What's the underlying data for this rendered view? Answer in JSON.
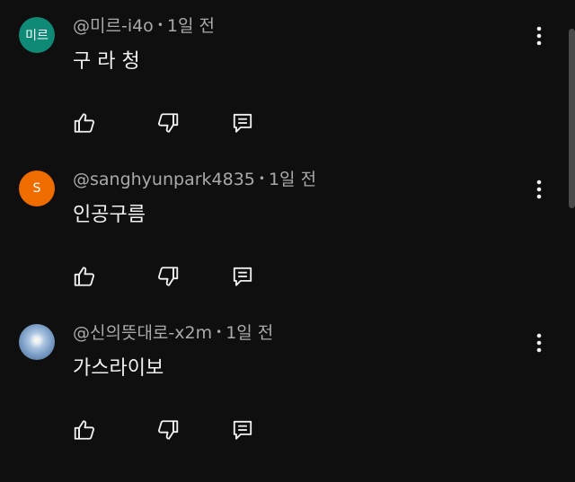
{
  "comments": [
    {
      "avatar_text": "미르",
      "author": "@미르-i4o",
      "time": "1일 전",
      "text": "구 라 청"
    },
    {
      "avatar_text": "S",
      "author": "@sanghyunpark4835",
      "time": "1일 전",
      "text": "인공구름"
    },
    {
      "avatar_text": "",
      "author": "@신의뜻대로-x2m",
      "time": "1일 전",
      "text": "가스라이보"
    }
  ],
  "icons": {
    "like": "thumbs-up-icon",
    "dislike": "thumbs-down-icon",
    "reply": "reply-comment-icon",
    "more": "more-vertical-icon"
  },
  "colors": {
    "background": "#0f0f0f",
    "text": "#f1f1f1",
    "meta": "#aaaaaa",
    "avatar_teal": "#0f8a76",
    "avatar_orange": "#ef6c00"
  }
}
